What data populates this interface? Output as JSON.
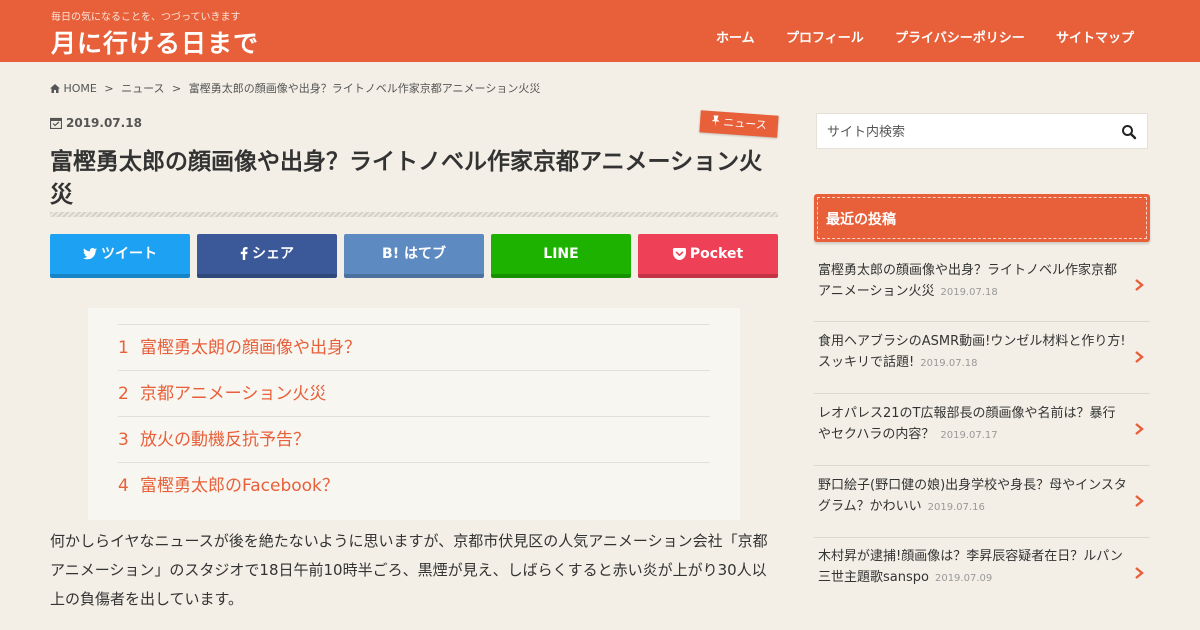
{
  "header": {
    "tagline": "毎日の気になることを、つづっていきます",
    "site_title": "月に行ける日まで",
    "nav": [
      "ホーム",
      "プロフィール",
      "プライバシーポリシー",
      "サイトマップ"
    ]
  },
  "breadcrumb": [
    "HOME",
    ">",
    "ニュース",
    ">",
    "富樫勇太郎の顔画像や出身？ライトノベル作家京都アニメーション火災"
  ],
  "post": {
    "date": "2019.07.18",
    "category": "ニュース",
    "title": "富樫勇太郎の顔画像や出身？ライトノベル作家京都アニメーション火災"
  },
  "share": {
    "twitter": "ツイート",
    "facebook": "シェア",
    "hatena": "B! はてブ",
    "line": "LINE",
    "pocket": "Pocket"
  },
  "toc": [
    {
      "num": "1",
      "text": "富樫勇太朗の顔画像や出身？"
    },
    {
      "num": "2",
      "text": "京都アニメーション火災"
    },
    {
      "num": "3",
      "text": "放火の動機反抗予告？"
    },
    {
      "num": "4",
      "text": "富樫勇太郎のFacebook？"
    }
  ],
  "body_text": "何かしらイヤなニュースが後を絶たないように思いますが、京都市伏見区の人気アニメーション会社「京都アニメーション」のスタジオで18日午前10時半ごろ、黒煙が見え、しばらくすると赤い炎が上がり30人以上の負傷者を出しています。",
  "sidebar": {
    "search_placeholder": "サイト内検索",
    "widget_title": "最近の投稿",
    "recent": [
      {
        "title": "富樫勇太郎の顔画像や出身？ライトノベル作家京都アニメーション火災",
        "date": "2019.07.18"
      },
      {
        "title": "食用ヘアブラシのASMR動画!ウンゼル材料と作り方!スッキリで話題!",
        "date": "2019.07.18"
      },
      {
        "title": "レオパレス21のT広報部長の顔画像や名前は？暴行やセクハラの内容？",
        "date": "2019.07.17"
      },
      {
        "title": "野口絵子(野口健の娘)出身学校や身長？母やインスタグラム？かわいい",
        "date": "2019.07.16"
      },
      {
        "title": "木村昇が逮捕!顔画像は？李昇辰容疑者在日？ルパン三世主題歌sanspo",
        "date": "2019.07.09"
      }
    ]
  },
  "colors": {
    "accent": "#e8603a",
    "twitter": "#1da1f2",
    "facebook": "#3b5998",
    "hatena": "#5d8ac0",
    "line": "#1db100",
    "pocket": "#ee4056"
  }
}
